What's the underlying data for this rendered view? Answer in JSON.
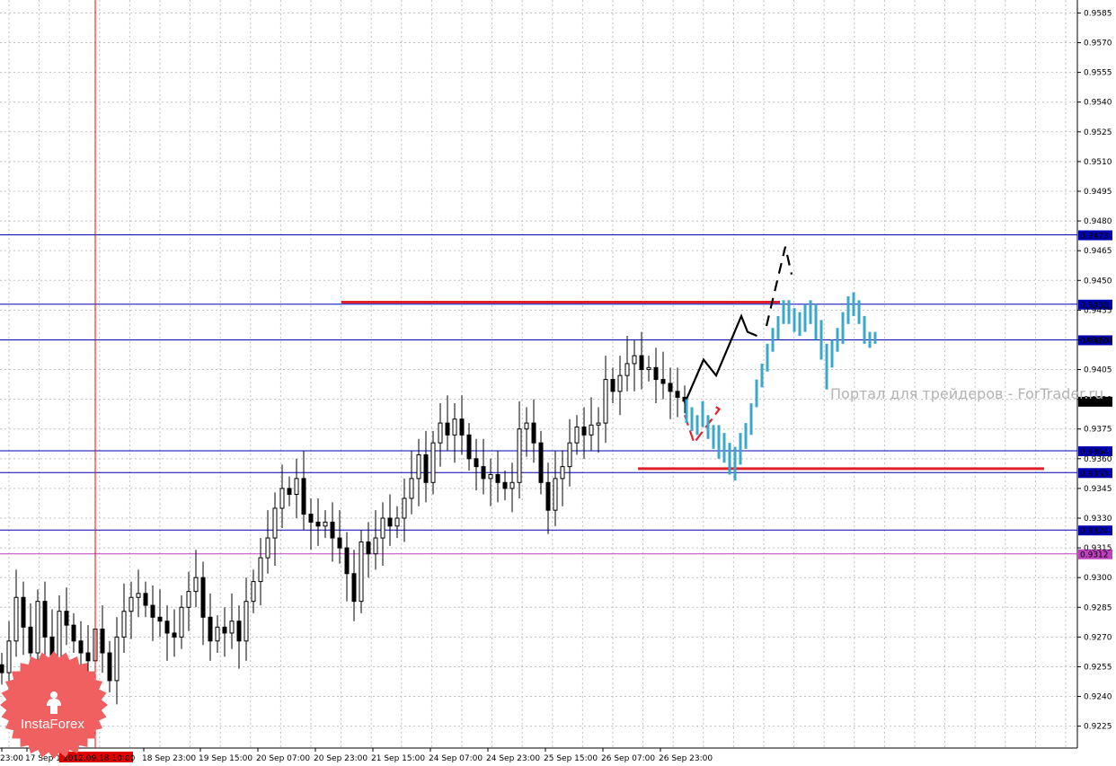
{
  "chart_data": {
    "type": "candlestick",
    "symbol_timeframe": "H4",
    "y_axis": {
      "min": 0.9217,
      "max": 0.959,
      "ticks": [
        "0.9585",
        "0.9570",
        "0.9555",
        "0.9540",
        "0.9525",
        "0.9510",
        "0.9495",
        "0.9480",
        "0.9465",
        "0.9450",
        "0.9435",
        "0.9420",
        "0.9405",
        "0.9390",
        "0.9375",
        "0.9360",
        "0.9345",
        "0.9330",
        "0.9315",
        "0.9300",
        "0.9285",
        "0.9270",
        "0.9255",
        "0.9240",
        "0.9225"
      ]
    },
    "x_axis": {
      "tick_labels": [
        "23:00",
        "17 Sep 1",
        "18 Sep 23:00",
        "19 Sep 15:00",
        "20 Sep 07:00",
        "20 Sep 23:00",
        "21 Sep 15:00",
        "24 Sep 07:00",
        "24 Sep 23:00",
        "25 Sep 15:00",
        "26 Sep 07:00",
        "26 Sep 23:00"
      ],
      "cursor_label": "2012.09.18 10:00"
    },
    "horizontal_levels": [
      {
        "value": 0.9473,
        "label": "0.9473",
        "color": "#0000b0"
      },
      {
        "value": 0.9438,
        "label": "0.9438",
        "color": "#0000b0"
      },
      {
        "value": 0.942,
        "label": "0.9420",
        "color": "#0000b0"
      },
      {
        "value": 0.9364,
        "label": "0.9364",
        "color": "#0000b0"
      },
      {
        "value": 0.9353,
        "label": "0.9353",
        "color": "#0000b0"
      },
      {
        "value": 0.9324,
        "label": "0.9324",
        "color": "#0000b0"
      },
      {
        "value": 0.9312,
        "label": "0.9312",
        "color": "#c040c0"
      }
    ],
    "current_price": {
      "value": 0.9389,
      "label": "0.9389"
    },
    "red_levels": [
      0.9439,
      0.9355
    ],
    "price_series": [
      0.9252,
      0.9268,
      0.929,
      0.9275,
      0.9262,
      0.9288,
      0.927,
      0.9255,
      0.9283,
      0.9276,
      0.9268,
      0.9262,
      0.9258,
      0.9274,
      0.9262,
      0.9248,
      0.927,
      0.9283,
      0.929,
      0.9292,
      0.9286,
      0.928,
      0.9278,
      0.9272,
      0.927,
      0.9285,
      0.9293,
      0.93,
      0.928,
      0.9268,
      0.9275,
      0.9272,
      0.9278,
      0.9268,
      0.9288,
      0.9298,
      0.931,
      0.932,
      0.9335,
      0.9345,
      0.9342,
      0.935,
      0.9332,
      0.9328,
      0.9326,
      0.9328,
      0.932,
      0.9315,
      0.9302,
      0.9288,
      0.9318,
      0.9312,
      0.932,
      0.933,
      0.9326,
      0.933,
      0.934,
      0.935,
      0.9362,
      0.9348,
      0.9368,
      0.9378,
      0.9372,
      0.938,
      0.9372,
      0.936,
      0.9356,
      0.935,
      0.9352,
      0.9348,
      0.9345,
      0.9348,
      0.9375,
      0.9378,
      0.9368,
      0.9348,
      0.9334,
      0.935,
      0.9356,
      0.9368,
      0.9376,
      0.9372,
      0.9377,
      0.9378,
      0.94,
      0.9394,
      0.9402,
      0.9408,
      0.9412,
      0.9405,
      0.9406,
      0.94,
      0.9398,
      0.9394,
      0.9391,
      0.9389
    ],
    "projection": {
      "black_path": [
        [
          0.0,
          0.9388
        ],
        [
          0.3,
          0.941
        ],
        [
          0.5,
          0.9402
        ],
        [
          0.9,
          0.9432
        ],
        [
          1.0,
          0.9424
        ],
        [
          1.15,
          0.9422
        ]
      ],
      "black_dashed": [
        [
          1.3,
          0.9427
        ],
        [
          1.6,
          0.9467
        ],
        [
          1.7,
          0.9453
        ]
      ],
      "red_dashed": [
        [
          0.0,
          0.9382
        ],
        [
          0.15,
          0.9368
        ],
        [
          0.55,
          0.9385
        ],
        [
          0.46,
          0.9387
        ]
      ],
      "cyan_bars": [
        [
          0.9378,
          0.939
        ],
        [
          0.9374,
          0.9386
        ],
        [
          0.9372,
          0.9382
        ],
        [
          0.9376,
          0.9389
        ],
        [
          0.937,
          0.9382
        ],
        [
          0.9365,
          0.9377
        ],
        [
          0.936,
          0.9377
        ],
        [
          0.9358,
          0.9373
        ],
        [
          0.9352,
          0.9368
        ],
        [
          0.9349,
          0.9366
        ],
        [
          0.9357,
          0.9373
        ],
        [
          0.9365,
          0.9378
        ],
        [
          0.9372,
          0.9388
        ],
        [
          0.9386,
          0.94
        ],
        [
          0.9396,
          0.9408
        ],
        [
          0.9404,
          0.9418
        ],
        [
          0.9414,
          0.9426
        ],
        [
          0.942,
          0.9432
        ],
        [
          0.9428,
          0.944
        ],
        [
          0.9428,
          0.944
        ],
        [
          0.9424,
          0.9436
        ],
        [
          0.9422,
          0.9434
        ],
        [
          0.9424,
          0.9438
        ],
        [
          0.9428,
          0.944
        ],
        [
          0.942,
          0.9438
        ],
        [
          0.941,
          0.943
        ],
        [
          0.9395,
          0.9418
        ],
        [
          0.9406,
          0.942
        ],
        [
          0.9414,
          0.9426
        ],
        [
          0.9418,
          0.9434
        ],
        [
          0.9428,
          0.9442
        ],
        [
          0.9432,
          0.9444
        ],
        [
          0.9428,
          0.944
        ],
        [
          0.9418,
          0.9432
        ],
        [
          0.9416,
          0.9424
        ],
        [
          0.9418,
          0.9424
        ]
      ]
    }
  },
  "watermark": "Портал для трейдеров - ForTrader.ru",
  "logo_text": "InstaForex",
  "colors": {
    "grid": "#c0c0c0",
    "level_blue": "#0000b0",
    "level_pink": "#c040c0",
    "red_level": "#e0202a",
    "cursor": "#ff0000",
    "projection_black": "#000000",
    "projection_cyan": "#3aa8c8",
    "projection_red": "#e0202a",
    "logo_bg": "#f06060"
  },
  "icons": {
    "logo": "instaforex-logo-icon"
  }
}
